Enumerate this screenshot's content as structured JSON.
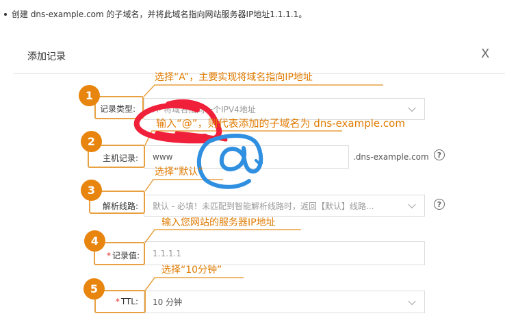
{
  "intro": {
    "text": "创建 dns-example.com 的子域名，并将此域名指向网站服务器IP地址1.1.1.1。"
  },
  "dialog": {
    "title": "添加记录",
    "close_glyph": "X"
  },
  "fields": {
    "record_type": {
      "label": "记录类型:",
      "value": "A- 将域名指向一个IPV4地址"
    },
    "host": {
      "label": "主机记录:",
      "value": "www",
      "suffix": ".dns-example.com"
    },
    "line": {
      "label": "解析线路:",
      "value": "默认 - 必填！未匹配到智能解析线路时，返回【默认】线路..."
    },
    "record_value": {
      "label": "记录值:",
      "required": "*",
      "value": "1.1.1.1"
    },
    "ttl": {
      "label": "TTL:",
      "required": "*",
      "value": "10 分钟"
    }
  },
  "help_glyph": "?",
  "steps": [
    "1",
    "2",
    "3",
    "4",
    "5"
  ],
  "annotations": {
    "step1": "选择“A”，主要实现将域名指向IP地址",
    "step2": "输入“@”，则代表添加的子域名为 dns-example.com",
    "step3": "选择“默认”",
    "step4": "输入您网站的服务器IP地址",
    "step5": "选择“10分钟”"
  },
  "colors": {
    "accent_orange": "#e8850f",
    "scribble_red": "#f0203a",
    "scribble_blue": "#2f8fe0",
    "required_red": "#e0312b"
  }
}
